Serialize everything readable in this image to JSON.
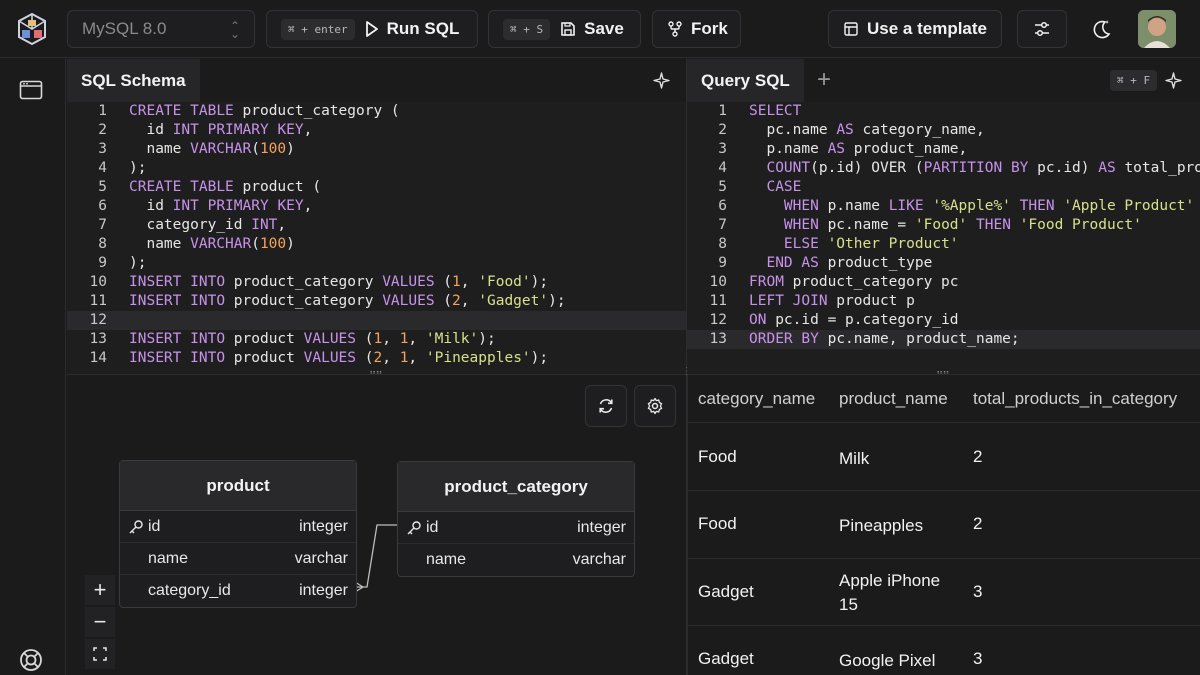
{
  "topbar": {
    "db_select": "MySQL 8.0",
    "run": {
      "shortcut": "⌘ + enter",
      "label": "Run SQL"
    },
    "save": {
      "shortcut": "⌘ + S",
      "label": "Save"
    },
    "fork": {
      "label": "Fork"
    },
    "template": {
      "label": "Use a template"
    }
  },
  "schema_panel": {
    "tab": "SQL Schema",
    "lines": [
      {
        "n": "1",
        "html": "<span class='kw'>CREATE</span> <span class='kw'>TABLE</span> product_category ("
      },
      {
        "n": "2",
        "html": "  id <span class='kw'>INT</span> <span class='kw'>PRIMARY</span> <span class='kw'>KEY</span>,"
      },
      {
        "n": "3",
        "html": "  name <span class='kw'>VARCHAR</span>(<span class='num'>100</span>)"
      },
      {
        "n": "4",
        "html": ");"
      },
      {
        "n": "5",
        "html": "<span class='kw'>CREATE</span> <span class='kw'>TABLE</span> product ("
      },
      {
        "n": "6",
        "html": "  id <span class='kw'>INT</span> <span class='kw'>PRIMARY</span> <span class='kw'>KEY</span>,"
      },
      {
        "n": "7",
        "html": "  category_id <span class='kw'>INT</span>,"
      },
      {
        "n": "8",
        "html": "  name <span class='kw'>VARCHAR</span>(<span class='num'>100</span>)"
      },
      {
        "n": "9",
        "html": ");"
      },
      {
        "n": "10",
        "html": "<span class='kw'>INSERT</span> <span class='kw'>INTO</span> product_category <span class='kw'>VALUES</span> (<span class='num'>1</span>, <span class='str'>'Food'</span>);"
      },
      {
        "n": "11",
        "html": "<span class='kw'>INSERT</span> <span class='kw'>INTO</span> product_category <span class='kw'>VALUES</span> (<span class='num'>2</span>, <span class='str'>'Gadget'</span>);"
      },
      {
        "n": "12",
        "html": "",
        "active": true
      },
      {
        "n": "13",
        "html": "<span class='kw'>INSERT</span> <span class='kw'>INTO</span> product <span class='kw'>VALUES</span> (<span class='num'>1</span>, <span class='num'>1</span>, <span class='str'>'Milk'</span>);"
      },
      {
        "n": "14",
        "html": "<span class='kw'>INSERT</span> <span class='kw'>INTO</span> product <span class='kw'>VALUES</span> (<span class='num'>2</span>, <span class='num'>1</span>, <span class='str'>'Pineapples'</span>);"
      }
    ]
  },
  "query_panel": {
    "tab": "Query SQL",
    "shortcut": "⌘ + F",
    "lines": [
      {
        "n": "1",
        "html": "<span class='kw'>SELECT</span>"
      },
      {
        "n": "2",
        "html": "  pc.name <span class='kw'>AS</span> category_name,"
      },
      {
        "n": "3",
        "html": "  p.name <span class='kw'>AS</span> product_name,"
      },
      {
        "n": "4",
        "html": "  <span class='fn'>COUNT</span>(p.id) OVER (<span class='kw'>PARTITION</span> <span class='kw'>BY</span> pc.id) <span class='kw'>AS</span> total_prod"
      },
      {
        "n": "5",
        "html": "  <span class='kw'>CASE</span>"
      },
      {
        "n": "6",
        "html": "    <span class='kw'>WHEN</span> p.name <span class='kw'>LIKE</span> <span class='str'>'%Apple%'</span> <span class='kw'>THEN</span> <span class='str'>'Apple Product'</span>"
      },
      {
        "n": "7",
        "html": "    <span class='kw'>WHEN</span> pc.name = <span class='str'>'Food'</span> <span class='kw'>THEN</span> <span class='str'>'Food Product'</span>"
      },
      {
        "n": "8",
        "html": "    <span class='kw'>ELSE</span> <span class='str'>'Other Product'</span>"
      },
      {
        "n": "9",
        "html": "  <span class='kw'>END</span> <span class='kw'>AS</span> product_type"
      },
      {
        "n": "10",
        "html": "<span class='kw'>FROM</span> product_category pc"
      },
      {
        "n": "11",
        "html": "<span class='kw'>LEFT</span> <span class='kw'>JOIN</span> product p"
      },
      {
        "n": "12",
        "html": "<span class='kw'>ON</span> pc.id = p.category_id"
      },
      {
        "n": "13",
        "html": "<span class='kw'>ORDER</span> <span class='kw'>BY</span> pc.name, product_name;",
        "active": true
      }
    ]
  },
  "er_diagram": {
    "tables": [
      {
        "name": "product",
        "columns": [
          {
            "name": "id",
            "type": "integer",
            "pk": true
          },
          {
            "name": "name",
            "type": "varchar"
          },
          {
            "name": "category_id",
            "type": "integer"
          }
        ]
      },
      {
        "name": "product_category",
        "columns": [
          {
            "name": "id",
            "type": "integer",
            "pk": true
          },
          {
            "name": "name",
            "type": "varchar"
          }
        ]
      }
    ],
    "zoom_in": "+",
    "zoom_out": "−"
  },
  "results": {
    "columns": [
      "category_name",
      "product_name",
      "total_products_in_category"
    ],
    "rows": [
      [
        "Food",
        "Milk",
        "2"
      ],
      [
        "Food",
        "Pineapples",
        "2"
      ],
      [
        "Gadget",
        "Apple iPhone 15",
        "3"
      ],
      [
        "Gadget",
        "Google Pixel",
        "3"
      ]
    ]
  }
}
